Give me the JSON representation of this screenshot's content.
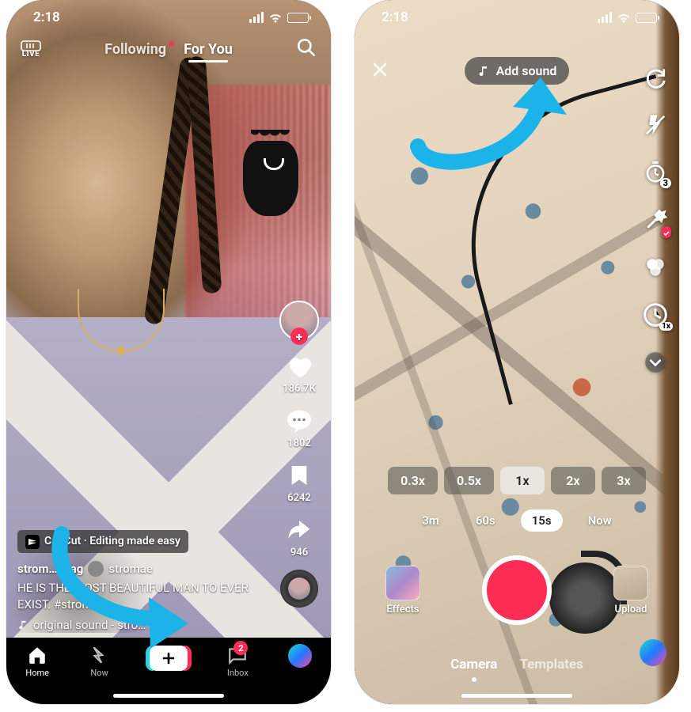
{
  "status": {
    "time": "2:18"
  },
  "feed": {
    "live_label": "LIVE",
    "tabs": {
      "following": "Following",
      "for_you": "For You"
    },
    "capcut_chip": "CapCut · Editing made easy",
    "username": "strom…spag",
    "reposter": "stromae",
    "caption": "HE IS THE MOST BEAUTIFUL MAN TO EVER EXIST. #stromae",
    "sound": "original sound - stro…   …ge",
    "rail": {
      "likes": "186.7K",
      "comments": "1802",
      "saves": "6242",
      "shares": "946"
    },
    "nav": {
      "home": "Home",
      "now": "Now",
      "inbox": "Inbox",
      "inbox_badge": "2"
    }
  },
  "camera": {
    "add_sound": "Add sound",
    "speeds": [
      "0.3x",
      "0.5x",
      "1x",
      "2x",
      "3x"
    ],
    "speed_active": "1x",
    "durations": [
      "3m",
      "60s",
      "15s",
      "Now"
    ],
    "duration_active": "15s",
    "effects_label": "Effects",
    "upload_label": "Upload",
    "modes": {
      "camera": "Camera",
      "templates": "Templates"
    },
    "timer_badge": "3",
    "speed_badge": "1x"
  }
}
